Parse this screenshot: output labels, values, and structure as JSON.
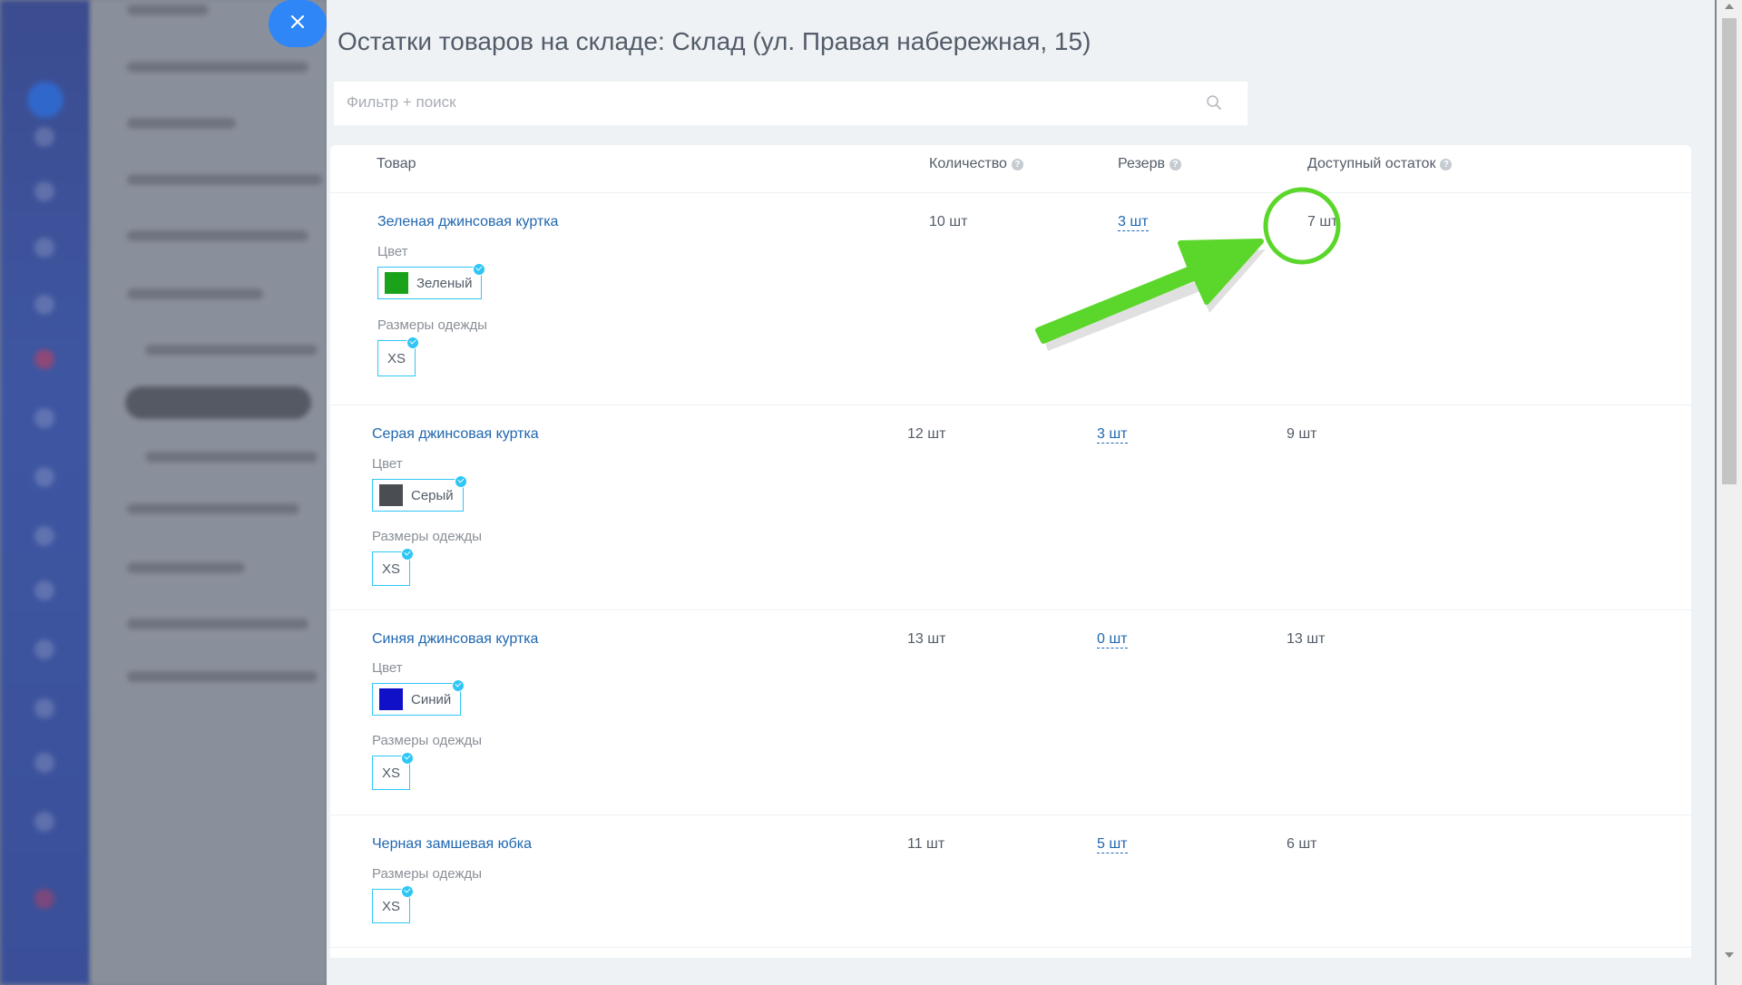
{
  "slider": {
    "title": "Остатки товаров на складе: Склад (ул. Правая набережная, 15)",
    "close_icon": "close-icon"
  },
  "search": {
    "placeholder": "Фильтр + поиск",
    "icon": "search-icon"
  },
  "table": {
    "columns": {
      "product": "Товар",
      "quantity": "Количество",
      "reserve": "Резерв",
      "available": "Доступный остаток"
    },
    "rows": [
      {
        "name": "Зеленая джинсовая куртка",
        "color_label": "Цвет",
        "color_value": "Зеленый",
        "color_hex": "#1aa31a",
        "size_label": "Размеры одежды",
        "size_value": "XS",
        "quantity": "10 шт",
        "reserve": "3 шт",
        "available": "7 шт"
      },
      {
        "name": "Серая джинсовая куртка",
        "color_label": "Цвет",
        "color_value": "Серый",
        "color_hex": "#4a4d52",
        "size_label": "Размеры одежды",
        "size_value": "XS",
        "quantity": "12 шт",
        "reserve": "3 шт",
        "available": "9 шт"
      },
      {
        "name": "Синяя джинсовая куртка",
        "color_label": "Цвет",
        "color_value": "Синий",
        "color_hex": "#1010c8",
        "size_label": "Размеры одежды",
        "size_value": "XS",
        "quantity": "13 шт",
        "reserve": "0 шт",
        "available": "13 шт"
      },
      {
        "name": "Черная замшевая юбка",
        "size_label": "Размеры одежды",
        "size_value": "XS",
        "quantity": "11 шт",
        "reserve": "5 шт",
        "available": "6 шт"
      }
    ]
  },
  "annotation": {
    "color": "#5bd62a",
    "target": "reserve of first row"
  }
}
